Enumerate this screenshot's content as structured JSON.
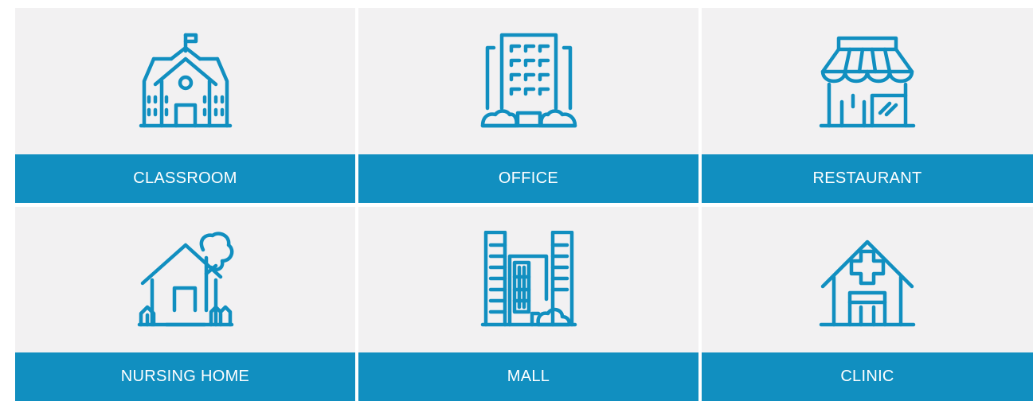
{
  "cards": [
    {
      "label": "CLASSROOM",
      "icon": "school-building-icon"
    },
    {
      "label": "OFFICE",
      "icon": "office-building-icon"
    },
    {
      "label": "RESTAURANT",
      "icon": "storefront-icon"
    },
    {
      "label": "NURSING HOME",
      "icon": "house-with-tree-icon"
    },
    {
      "label": "MALL",
      "icon": "mall-buildings-icon"
    },
    {
      "label": "CLINIC",
      "icon": "medical-clinic-icon"
    }
  ],
  "colors": {
    "accent": "#118fc0",
    "card_background": "#f2f1f2",
    "label_text": "#ffffff"
  }
}
